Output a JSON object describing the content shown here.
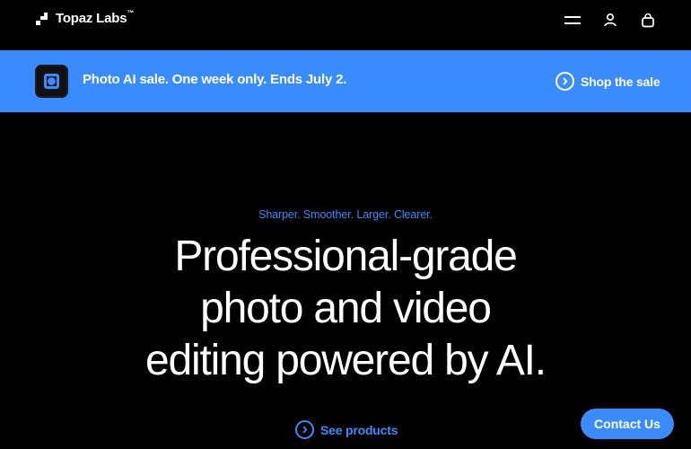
{
  "brand": {
    "name": "Topaz Labs",
    "trademark": "™"
  },
  "nav": {
    "icons": [
      {
        "name": "menu-icon"
      },
      {
        "name": "account-icon"
      },
      {
        "name": "cart-icon"
      }
    ]
  },
  "banner": {
    "app_icon": "photo-ai-app-icon",
    "text": "Photo AI sale. One week only. Ends July 2.",
    "link_label": "Shop the sale",
    "background": "#3a8bfd"
  },
  "hero": {
    "tagline": "Sharper. Smoother. Larger. Clearer.",
    "headline_lines": [
      "Professional-grade",
      "photo and video",
      "editing powered by AI."
    ],
    "cta_label": "See products"
  },
  "contact": {
    "label": "Contact Us"
  },
  "colors": {
    "accent": "#3a8bfd",
    "background": "#000000",
    "text": "#ffffff"
  }
}
